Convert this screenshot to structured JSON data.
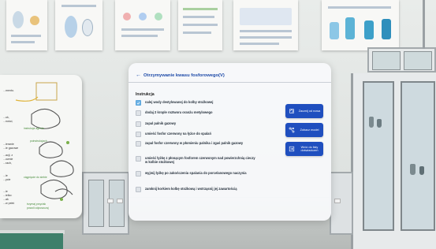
{
  "panel": {
    "title": "Otrzymywanie kwasu fosforowego(V)",
    "section_title": "Instrukcja",
    "steps": [
      {
        "text": "nalej wody destylowanej do kolby stożkowej",
        "done": true
      },
      {
        "text": "dodaj 2 krople roztworu oranżu metylowego",
        "done": false
      },
      {
        "text": "zapal palnik gazowy",
        "done": false
      },
      {
        "text": "umieść fosfor czerwony na łyżce do spalań",
        "done": false
      },
      {
        "text": "zapal fosfor czerwony w płomieniu palnika i zgaś palnik gazowy",
        "done": false
      },
      {
        "text": "umieść łyżkę z płonącym fosforem czerwonym nad powierzchnią cieczy w kolbie stożkowej",
        "done": false
      },
      {
        "text": "wyjmij łyżkę po zakończeniu spalania do porcelanowego naczynia",
        "done": false
      },
      {
        "text": "zamknij korkiem kolbę stożkową i wstrząsnij jej zawartością",
        "done": false
      }
    ],
    "buttons": {
      "restart": "Zacznij od nowa",
      "model": "Zobacz model",
      "return": "Wróć do listy doświadczeń"
    },
    "accent_color": "#1f4fbf",
    "check_color": "#6db3e6"
  },
  "guide_board": {
    "texts": [
      "...mento.",
      "...uk,",
      "...ności,",
      "...ieranie",
      "...ie gazowe",
      "...acji, z",
      "...ownie",
      "...rach,",
      "...ie",
      "...ycie",
      "...ie",
      "...ielko:",
      "...ak",
      "...w pełni"
    ],
    "green_texts": [
      "instrukcja agenta",
      "poinstrukcjach",
      "ciągnięcie do siebie",
      "trzymaj przycisk",
      "powoli odpuszczaj"
    ]
  }
}
